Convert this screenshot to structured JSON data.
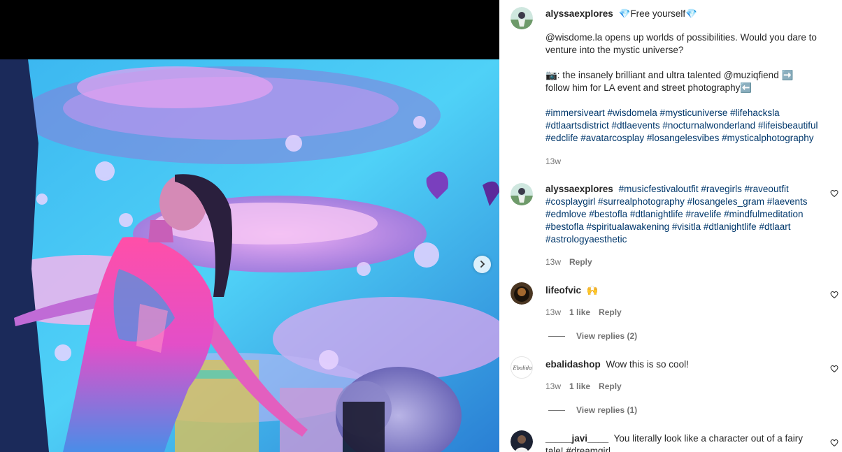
{
  "post": {
    "author": "alyssaexplores",
    "caption_title": "💎Free yourself💎",
    "caption_p1": "@wisdome.la opens up worlds of possibilities. Would you dare to venture into the mystic universe?",
    "caption_p2": "📷: the insanely brilliant and ultra talented @muziqfiend ➡️ follow him for LA event and street photography⬅️",
    "caption_p3": "#immersiveart #wisdomela #mysticuniverse #lifehacksla #dtlaartsdistrict #dtlaevents #nocturnalwonderland #lifeisbeautiful #edclife #avatarcosplay #losangelesvibes #mysticalphotography",
    "time": "13w"
  },
  "comments": [
    {
      "user": "alyssaexplores",
      "text": "#musicfestivaloutfit #ravegirls #raveoutfit #cosplaygirl #surrealphotography #losangeles_gram #laevents #edmlove #bestofla #dtlanightlife #ravelife #mindfulmeditation #bestofla #spiritualawakening #visitla #dtlanightlife #dtlaart #astrologyaesthetic",
      "time": "13w",
      "reply": "Reply"
    },
    {
      "user": "lifeofvic",
      "text": "🙌",
      "time": "13w",
      "likes": "1 like",
      "reply": "Reply",
      "view_replies": "View replies (2)"
    },
    {
      "user": "ebalidashop",
      "text": "Wow this is so cool!",
      "time": "13w",
      "likes": "1 like",
      "reply": "Reply",
      "view_replies": "View replies (1)",
      "avatar_text": "Ebalida"
    },
    {
      "user": "_____javi____",
      "text": "You literally look like a character out of a fairy tale! #dreamgirl"
    }
  ],
  "icons": {
    "next": "chevron-right-icon",
    "like": "heart-icon"
  },
  "colors": {
    "hashtag": "#00376b",
    "secondary_text": "#737373"
  }
}
